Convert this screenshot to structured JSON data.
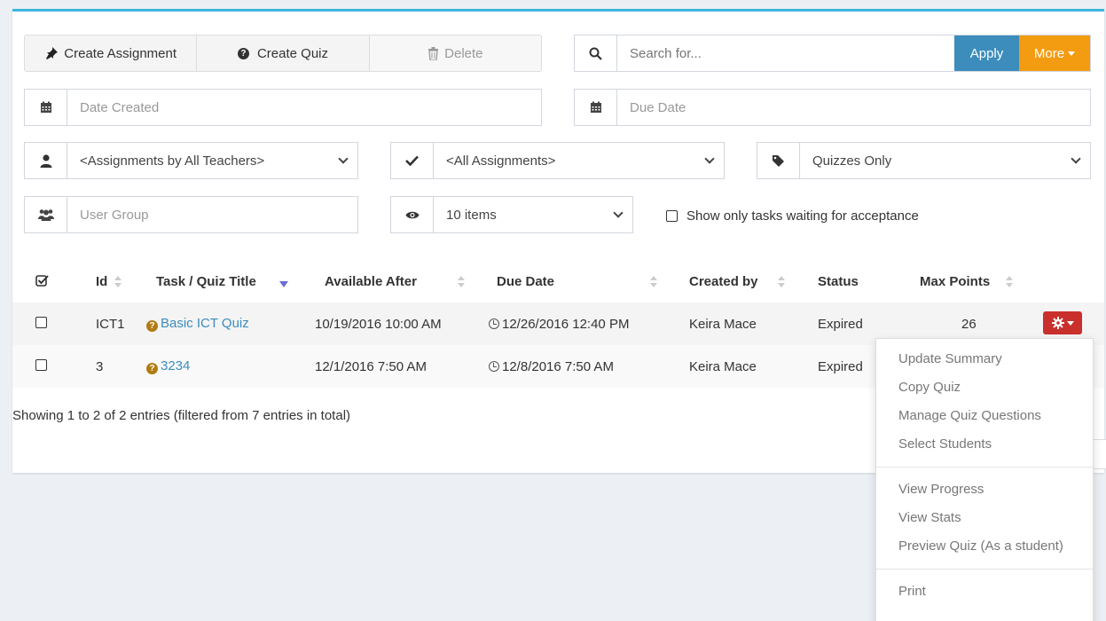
{
  "toolbar": {
    "create_assignment": "Create Assignment",
    "create_quiz": "Create Quiz",
    "delete": "Delete"
  },
  "search": {
    "placeholder": "Search for...",
    "apply": "Apply",
    "more": "More"
  },
  "filters": {
    "date_created": "Date Created",
    "due_date": "Due Date",
    "teachers": "<Assignments by All Teachers>",
    "assignments": "<All Assignments>",
    "quiz_type": "Quizzes Only",
    "user_group": "User Group",
    "page_size": "10 items",
    "accept_label": "Show only tasks waiting for acceptance"
  },
  "table": {
    "headers": {
      "id": "Id",
      "title": "Task / Quiz Title",
      "available_after": "Available After",
      "due_date": "Due Date",
      "created_by": "Created by",
      "status": "Status",
      "max_points": "Max Points"
    },
    "rows": [
      {
        "id": "ICT1",
        "title": "Basic ICT Quiz",
        "available_after": "10/19/2016 10:00 AM",
        "due_date": "12/26/2016 12:40 PM",
        "created_by": "Keira Mace",
        "status": "Expired",
        "max_points": "26"
      },
      {
        "id": "3",
        "title": "3234",
        "available_after": "12/1/2016 7:50 AM",
        "due_date": "12/8/2016 7:50 AM",
        "created_by": "Keira Mace",
        "status": "Expired",
        "max_points": ""
      }
    ]
  },
  "summary": "Showing 1 to 2 of 2 entries (filtered from 7 entries in total)",
  "menu": {
    "update_summary": "Update Summary",
    "copy_quiz": "Copy Quiz",
    "manage_questions": "Manage Quiz Questions",
    "select_students": "Select Students",
    "view_progress": "View Progress",
    "view_stats": "View Stats",
    "preview_quiz": "Preview Quiz (As a student)",
    "print": "Print"
  },
  "colors": {
    "accent_top": "#3bb8e0",
    "apply": "#3c8dbc",
    "more": "#f39c12",
    "gear": "#c9302c"
  }
}
